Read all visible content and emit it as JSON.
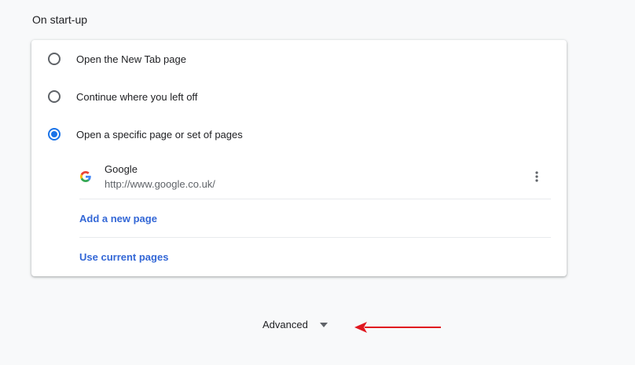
{
  "section": {
    "title": "On start-up"
  },
  "startup_options": [
    {
      "label": "Open the New Tab page",
      "checked": false
    },
    {
      "label": "Continue where you left off",
      "checked": false
    },
    {
      "label": "Open a specific page or set of pages",
      "checked": true
    }
  ],
  "startup_page": {
    "name": "Google",
    "url": "http://www.google.co.uk/",
    "favicon": "google-g-icon",
    "menu_icon": "more-vertical-icon"
  },
  "actions": {
    "add_page": "Add a new page",
    "use_current": "Use current pages"
  },
  "advanced": {
    "label": "Advanced",
    "icon": "chevron-down-icon"
  },
  "annotation": {
    "icon": "red-arrow-icon",
    "color": "#e0161f"
  },
  "colors": {
    "accent": "#1a73e8",
    "link": "#3367d6",
    "background": "#f8f9fa",
    "card": "#ffffff"
  }
}
